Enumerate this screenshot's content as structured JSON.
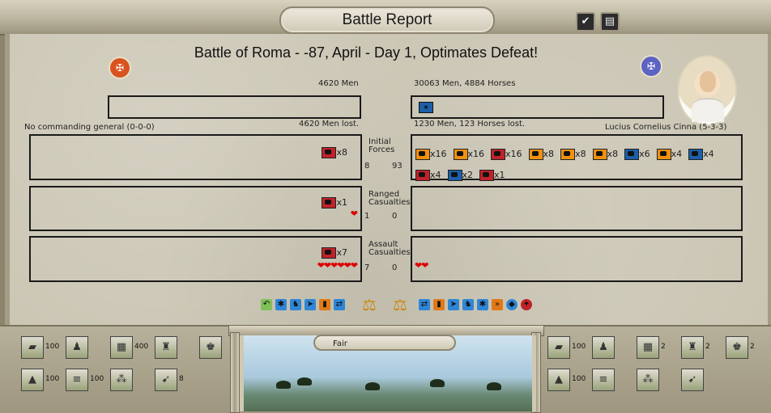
{
  "window": {
    "title": "Battle Report",
    "check_icon": "checkmark-icon",
    "ledger_icon": "ledger-icon"
  },
  "headline": "Battle of Roma - -87, April - Day 1, Optimates Defeat!",
  "left": {
    "emblem_icon": "eagle-standard-icon",
    "emblem_color": "#d9531e",
    "men": "4620 Men",
    "general": "No commanding general (0-0-0)",
    "lost": "4620 Men lost.",
    "initial_forces": [
      {
        "color": "#c0222a",
        "count": "x8"
      }
    ],
    "ranged_casualties": [
      {
        "color": "#c0222a",
        "count": "x1"
      }
    ],
    "ranged_hearts": 1,
    "assault_casualties": [
      {
        "color": "#c0222a",
        "count": "x7"
      }
    ],
    "assault_hearts": 6
  },
  "right": {
    "emblem_icon": "eagle-standard-icon",
    "emblem_color": "#5c63c4",
    "men": "30063 Men, 4884 Horses",
    "general": "Lucius Cornelius Cinna (5-3-3)",
    "lost": "1230 Men, 123 Horses lost.",
    "initial_forces": [
      {
        "color": "#f09010",
        "count": "x16"
      },
      {
        "color": "#f09010",
        "count": "x16"
      },
      {
        "color": "#c0222a",
        "count": "x16"
      },
      {
        "color": "#f09010",
        "count": "x8"
      },
      {
        "color": "#f09010",
        "count": "x8"
      },
      {
        "color": "#f09010",
        "count": "x8"
      },
      {
        "color": "#1c5fa8",
        "count": "x6"
      },
      {
        "color": "#f09010",
        "count": "x4"
      },
      {
        "color": "#1c5fa8",
        "count": "x4"
      },
      {
        "color": "#c0222a",
        "count": "x4"
      },
      {
        "color": "#1c5fa8",
        "count": "x2"
      },
      {
        "color": "#c0222a",
        "count": "x1"
      }
    ],
    "assault_hearts": 2
  },
  "rows": {
    "initial": {
      "label": "Initial Forces",
      "left": "8",
      "right": "93"
    },
    "ranged": {
      "label": "Ranged Casualties",
      "left": "1",
      "right": "0"
    },
    "assault": {
      "label": "Assault Casualties",
      "left": "7",
      "right": "0"
    }
  },
  "tactics": {
    "left_icons": [
      "flank-icon",
      "skirmish-icon",
      "cavalry-icon",
      "charge-icon",
      "infantry-icon",
      "maneuver-icon"
    ],
    "right_icons": [
      "maneuver-icon",
      "infantry-icon",
      "charge-icon",
      "cavalry-icon",
      "skirmish-icon",
      "advance-icon",
      "shield-icon",
      "morale-icon"
    ],
    "scales_icon": "scales-icon"
  },
  "terrain": {
    "weather": "Fair",
    "left_tiles": [
      {
        "icon": "terrain-plain-icon",
        "value": "100"
      },
      {
        "icon": "soldier-icon",
        "value": ""
      },
      {
        "icon": "fortified-camp-icon",
        "value": "400"
      },
      {
        "icon": "legion-icon",
        "value": ""
      },
      {
        "icon": "general-icon",
        "value": ""
      },
      {
        "icon": "terrain-hill-icon",
        "value": "100"
      },
      {
        "icon": "road-icon",
        "value": "100"
      },
      {
        "icon": "formation-icon",
        "value": ""
      },
      {
        "icon": "archer-icon",
        "value": "8"
      }
    ],
    "right_tiles": [
      {
        "icon": "terrain-plain-icon",
        "value": "100"
      },
      {
        "icon": "soldier-icon",
        "value": ""
      },
      {
        "icon": "fortified-camp-icon",
        "value": "2"
      },
      {
        "icon": "legion-icon",
        "value": "2"
      },
      {
        "icon": "general-icon",
        "value": "2"
      },
      {
        "icon": "terrain-hill-icon",
        "value": "100"
      },
      {
        "icon": "road-icon",
        "value": ""
      },
      {
        "icon": "formation-icon",
        "value": ""
      },
      {
        "icon": "archer-icon",
        "value": ""
      }
    ]
  }
}
